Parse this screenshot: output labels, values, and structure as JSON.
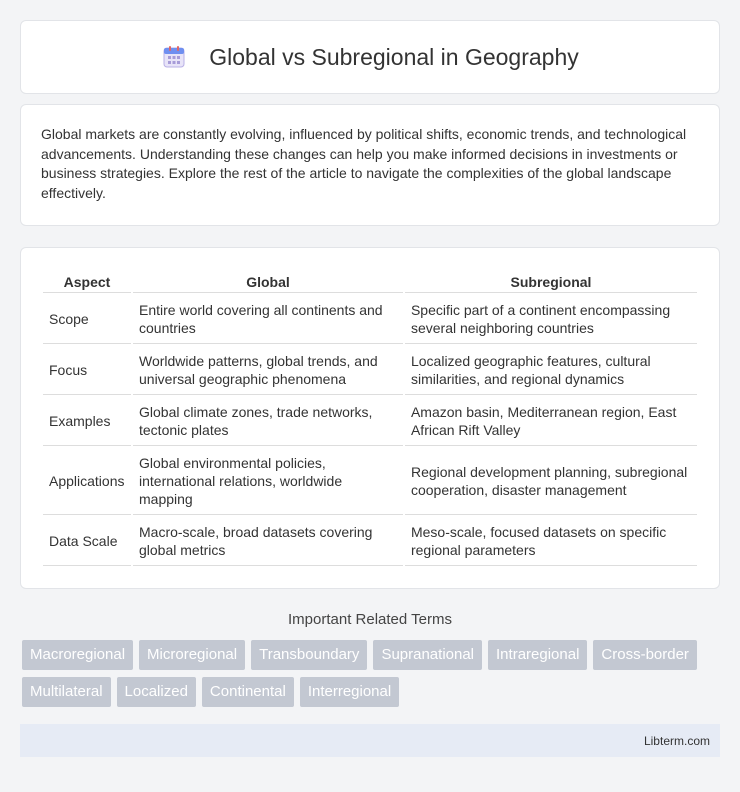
{
  "header": {
    "icon": "calendar-icon",
    "title": "Global vs Subregional in Geography"
  },
  "intro": {
    "text": "Global markets are constantly evolving, influenced by political shifts, economic trends, and technological advancements. Understanding these changes can help you make informed decisions in investments or business strategies. Explore the rest of the article to navigate the complexities of the global landscape effectively."
  },
  "table": {
    "headers": [
      "Aspect",
      "Global",
      "Subregional"
    ],
    "rows": [
      [
        "Scope",
        "Entire world covering all continents and countries",
        "Specific part of a continent encompassing several neighboring countries"
      ],
      [
        "Focus",
        "Worldwide patterns, global trends, and universal geographic phenomena",
        "Localized geographic features, cultural similarities, and regional dynamics"
      ],
      [
        "Examples",
        "Global climate zones, trade networks, tectonic plates",
        "Amazon basin, Mediterranean region, East African Rift Valley"
      ],
      [
        "Applications",
        "Global environmental policies, international relations, worldwide mapping",
        "Regional development planning, subregional cooperation, disaster management"
      ],
      [
        "Data Scale",
        "Macro-scale, broad datasets covering global metrics",
        "Meso-scale, focused datasets on specific regional parameters"
      ]
    ]
  },
  "related": {
    "title": "Important Related Terms",
    "tags": [
      "Macroregional",
      "Microregional",
      "Transboundary",
      "Supranational",
      "Intraregional",
      "Cross-border",
      "Multilateral",
      "Localized",
      "Continental",
      "Interregional"
    ]
  },
  "footer": {
    "text": "Libterm.com"
  }
}
